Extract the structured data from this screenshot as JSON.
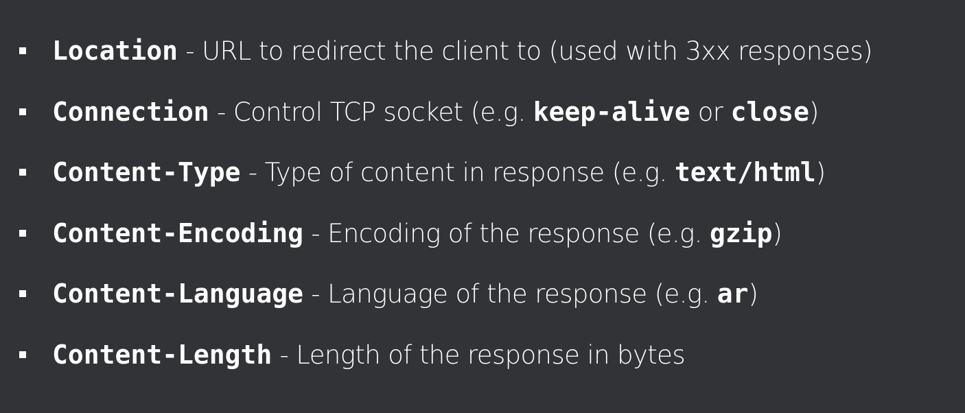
{
  "headers": [
    {
      "name": "Location",
      "sep": " - ",
      "desc": "URL to redirect the client to (used with 3xx responses)"
    },
    {
      "name": "Connection",
      "sep": " - ",
      "desc": "Control TCP socket (e.g. ",
      "ex1": "keep-alive",
      "mid": " or ",
      "ex2": "close",
      "end": ")"
    },
    {
      "name": "Content-Type",
      "sep": " - ",
      "desc": "Type of content in response (e.g. ",
      "ex1": "text/html",
      "end": ")"
    },
    {
      "name": "Content-Encoding",
      "sep": " - ",
      "desc": "Encoding of the response (e.g. ",
      "ex1": "gzip",
      "end": ")"
    },
    {
      "name": "Content-Language",
      "sep": " - ",
      "desc": "Language of the response (e.g. ",
      "ex1": "ar",
      "end": ")"
    },
    {
      "name": "Content-Length",
      "sep": " - ",
      "desc": "Length of the response in bytes"
    }
  ]
}
